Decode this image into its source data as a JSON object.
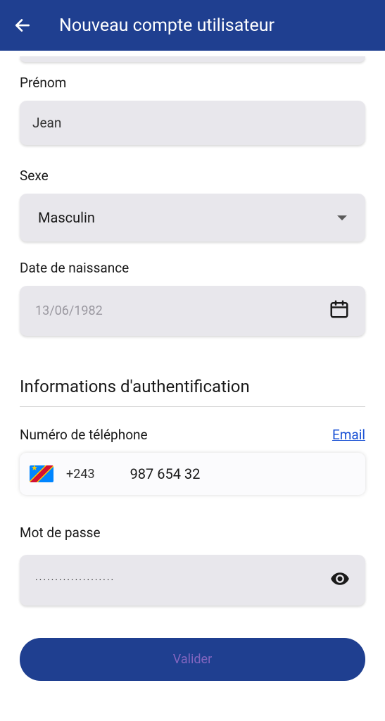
{
  "header": {
    "title": "Nouveau compte utilisateur"
  },
  "form": {
    "firstname": {
      "label": "Prénom",
      "value": "Jean"
    },
    "gender": {
      "label": "Sexe",
      "value": "Masculin"
    },
    "dob": {
      "label": "Date de naissance",
      "placeholder": "13/06/1982"
    }
  },
  "auth": {
    "section_title": "Informations d'authentification",
    "phone": {
      "label": "Numéro de téléphone",
      "email_link": "Email",
      "country_code": "+243",
      "number": "987 654 32"
    },
    "password": {
      "label": "Mot de passe",
      "value_masked": "····················"
    }
  },
  "actions": {
    "submit_label": "Valider"
  }
}
